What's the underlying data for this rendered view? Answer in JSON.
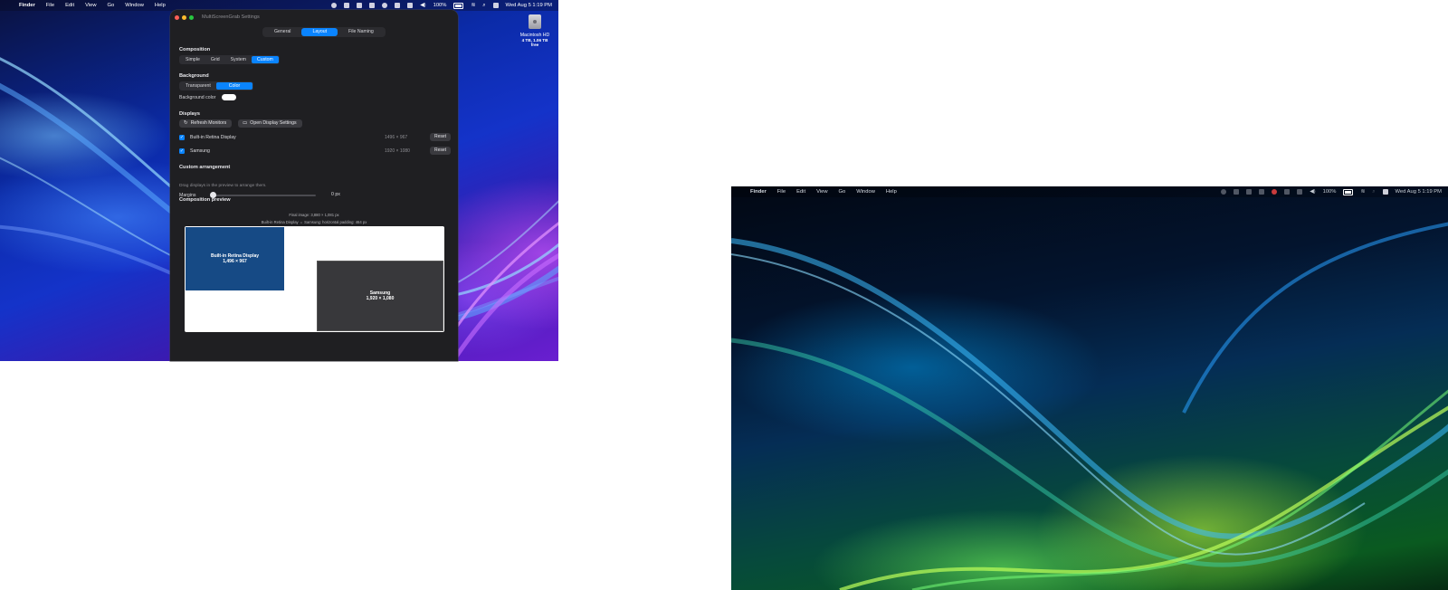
{
  "desktop1": {
    "menubar": {
      "app": "Finder",
      "items": [
        "File",
        "Edit",
        "View",
        "Go",
        "Window",
        "Help"
      ],
      "battery": "100%",
      "datetime": "Wed Aug 5  1:19 PM"
    },
    "drive": {
      "name": "Macintosh HD",
      "free": "4 TB, 1.06 TB free"
    }
  },
  "window": {
    "title": "MultiScreenGrab Settings",
    "tabs": [
      "General",
      "Layout",
      "File Naming"
    ],
    "active_tab": "Layout",
    "composition": {
      "title": "Composition",
      "options": [
        "Simple",
        "Grid",
        "System",
        "Custom"
      ],
      "selected": "Custom"
    },
    "background": {
      "title": "Background",
      "options": [
        "Transparent",
        "Color"
      ],
      "selected": "Color",
      "color_label": "Background color",
      "color_value": "#ffffff"
    },
    "displays": {
      "title": "Displays",
      "refresh_label": "Refresh Monitors",
      "open_settings_label": "Open Display Settings",
      "list": [
        {
          "name": "Built-in Retina Display",
          "resolution": "1496 × 967",
          "checked": true,
          "reset": "Reset"
        },
        {
          "name": "Samsung",
          "resolution": "1920 × 1080",
          "checked": true,
          "reset": "Reset"
        }
      ]
    },
    "arrangement": {
      "title": "Custom arrangement",
      "hint": "Drag displays in the preview to arrange them.",
      "margins_label": "Margins",
      "margins_value": "0 px"
    },
    "preview": {
      "title": "Composition preview",
      "final_image": "Final image: 3,880 × 1,081 px",
      "padding_note": "Built-in Retina Display ⇔ Samsung: horizontal padding: 464 px",
      "monitors": [
        {
          "name": "Built-in Retina Display",
          "size": "1,496 × 967",
          "color": "#164a85"
        },
        {
          "name": "Samsung",
          "size": "1,920 × 1,080",
          "color": "#38383b"
        }
      ]
    }
  },
  "desktop2": {
    "menubar": {
      "app": "Finder",
      "items": [
        "File",
        "Edit",
        "View",
        "Go",
        "Window",
        "Help"
      ],
      "battery": "100%",
      "datetime": "Wed Aug 5  1:19 PM"
    }
  },
  "colors": {
    "accent": "#0a84ff",
    "window_bg": "#1f1f22"
  }
}
